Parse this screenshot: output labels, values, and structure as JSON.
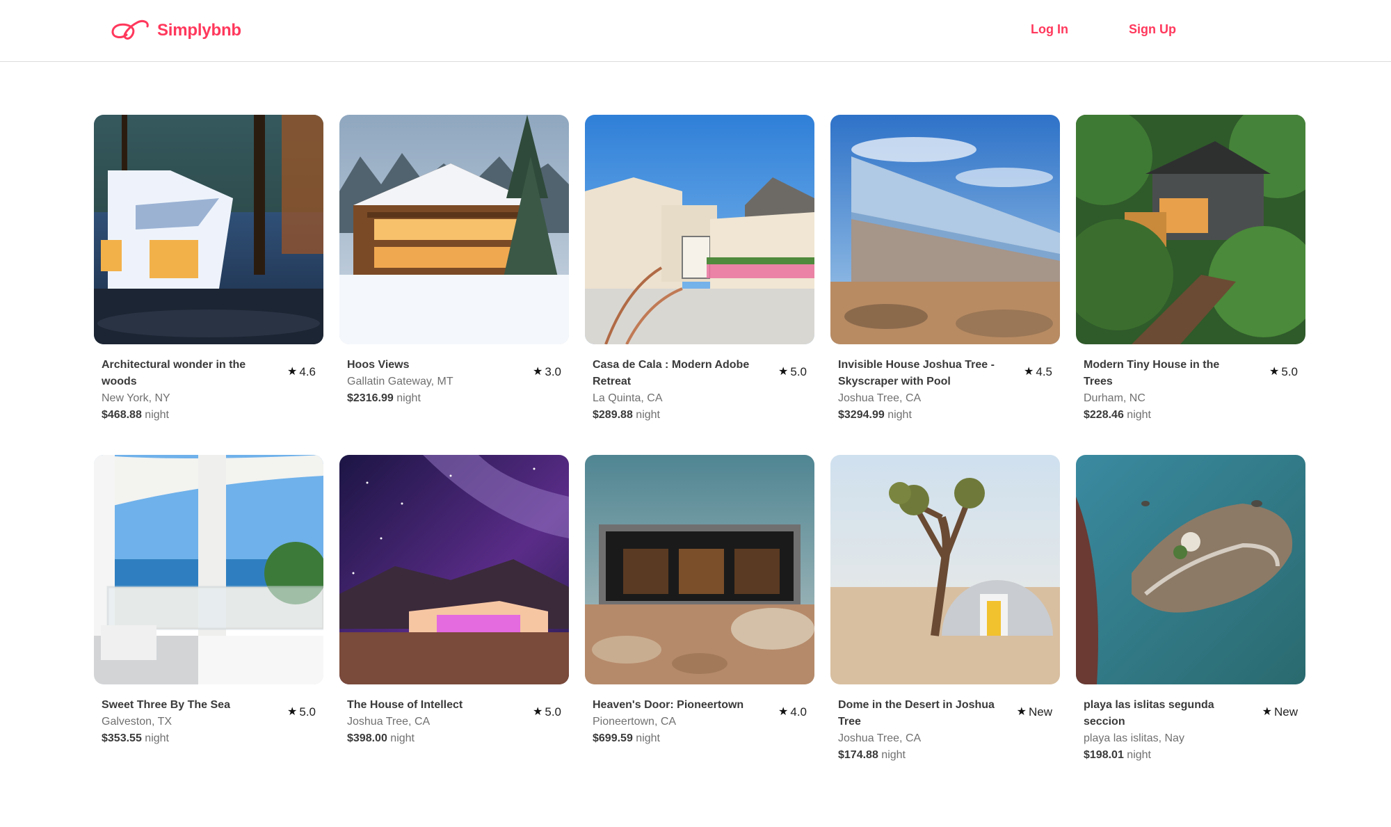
{
  "header": {
    "brand": "Simplybnb",
    "login_label": "Log In",
    "signup_label": "Sign Up",
    "brand_color": "#ff385c"
  },
  "listings": [
    {
      "title": "Architectural wonder in the woods",
      "location": "New York, NY",
      "price": "$468.88",
      "unit": "night",
      "rating": "4.6"
    },
    {
      "title": "Hoos Views",
      "location": "Gallatin Gateway, MT",
      "price": "$2316.99",
      "unit": "night",
      "rating": "3.0"
    },
    {
      "title": "Casa de Cala : Modern Adobe Retreat",
      "location": "La Quinta, CA",
      "price": "$289.88",
      "unit": "night",
      "rating": "5.0"
    },
    {
      "title": "Invisible House Joshua Tree - Skyscraper with Pool",
      "location": "Joshua Tree, CA",
      "price": "$3294.99",
      "unit": "night",
      "rating": "4.5"
    },
    {
      "title": "Modern Tiny House in the Trees",
      "location": "Durham, NC",
      "price": "$228.46",
      "unit": "night",
      "rating": "5.0"
    },
    {
      "title": "Sweet Three By The Sea",
      "location": "Galveston, TX",
      "price": "$353.55",
      "unit": "night",
      "rating": "5.0"
    },
    {
      "title": "The House of Intellect",
      "location": "Joshua Tree, CA",
      "price": "$398.00",
      "unit": "night",
      "rating": "5.0"
    },
    {
      "title": "Heaven's Door: Pioneertown",
      "location": "Pioneertown, CA",
      "price": "$699.59",
      "unit": "night",
      "rating": "4.0"
    },
    {
      "title": "Dome in the Desert in Joshua Tree",
      "location": "Joshua Tree, CA",
      "price": "$174.88",
      "unit": "night",
      "rating": "New"
    },
    {
      "title": "playa las islitas segunda seccion",
      "location": "playa las islitas, Nay",
      "price": "$198.01",
      "unit": "night",
      "rating": "New"
    }
  ]
}
